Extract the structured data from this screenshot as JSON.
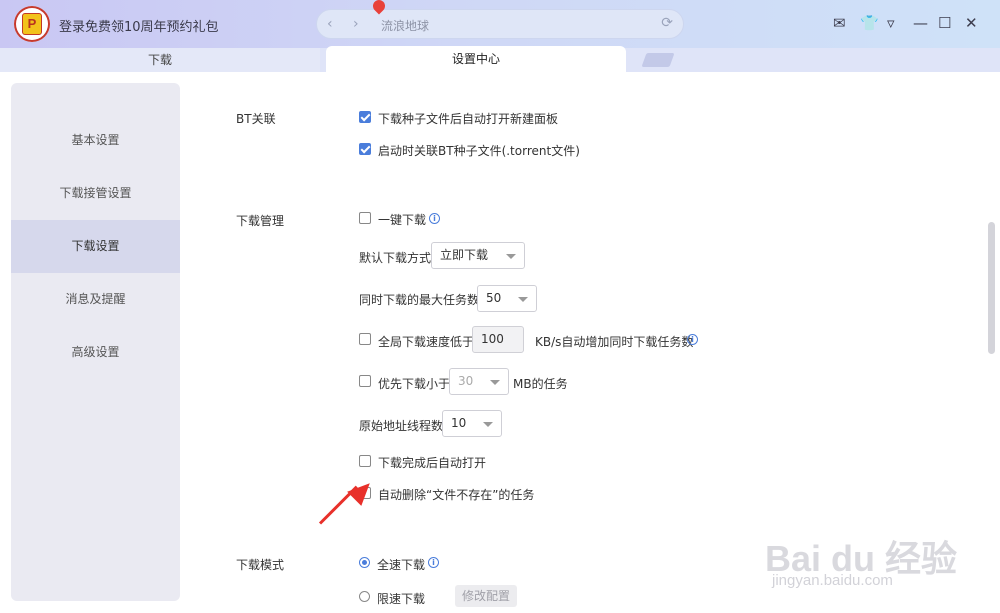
{
  "header": {
    "logo_text": "P",
    "promo_text": "登录免费领10周年预约礼包",
    "address_text": "流浪地球",
    "nav_back": "‹",
    "nav_forward": "›",
    "reload_icon": "⟳",
    "window_controls": [
      "✉",
      "👕",
      "▿",
      "—",
      "☐",
      "✕"
    ]
  },
  "tabs": {
    "download": "下载",
    "settings": "设置中心"
  },
  "sidebar": {
    "items": [
      {
        "label": "基本设置"
      },
      {
        "label": "下载接管设置"
      },
      {
        "label": "下载设置"
      },
      {
        "label": "消息及提醒"
      },
      {
        "label": "高级设置"
      }
    ],
    "active_index": 2
  },
  "bt": {
    "title": "BT关联",
    "opt1": {
      "label": "下载种子文件后自动打开新建面板",
      "checked": true
    },
    "opt2": {
      "label": "启动时关联BT种子文件(.torrent文件)",
      "checked": true
    }
  },
  "dl_manage": {
    "title": "下载管理",
    "one_click": {
      "label": "一键下载",
      "checked": false
    },
    "default_mode_label": "默认下载方式",
    "default_mode_value": "立即下载",
    "max_tasks_label": "同时下载的最大任务数",
    "max_tasks_value": "50",
    "speed_label": "全局下载速度低于",
    "speed_value": "100",
    "speed_suffix": "KB/s自动增加同时下载任务数",
    "priority_label": "优先下载小于",
    "priority_value": "30",
    "priority_suffix": "MB的任务",
    "threads_label": "原始地址线程数",
    "threads_value": "10",
    "auto_open": {
      "label": "下载完成后自动打开",
      "checked": false
    },
    "auto_delete": {
      "label": "自动删除“文件不存在”的任务",
      "checked": false
    }
  },
  "dl_mode": {
    "title": "下载模式",
    "full_speed": {
      "label": "全速下载",
      "selected": true
    },
    "limited": {
      "label": "限速下载",
      "selected": false
    },
    "modify_button": "修改配置"
  },
  "watermark": {
    "line1": "Bai du 经验",
    "line2": "jingyan.baidu.com"
  },
  "colors": {
    "accent": "#4a7ddb",
    "arrow": "#e8302a"
  }
}
